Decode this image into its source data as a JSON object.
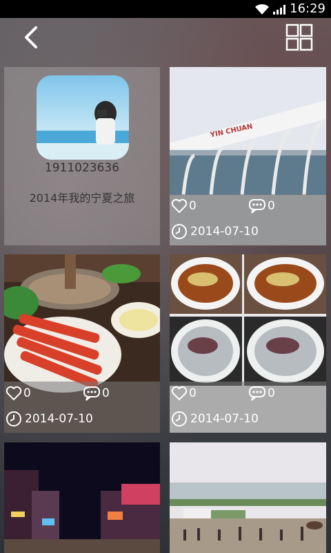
{
  "status": {
    "time": "16:29"
  },
  "header": {
    "back_icon": "back-arrow-icon",
    "grid_icon": "grid-view-icon"
  },
  "profile": {
    "user_id": "1911023636",
    "album_title": "2014年我的宁夏之旅"
  },
  "cards": [
    {
      "likes": "0",
      "comments": "0",
      "date": "2014-07-10",
      "photo": "Yinchuan airport terminal",
      "watermark": "YIN CHUAN"
    },
    {
      "likes": "0",
      "comments": "0",
      "date": "2014-07-10",
      "photo": "hotpot dinner with raw meat"
    },
    {
      "likes": "0",
      "comments": "0",
      "date": "2014-07-10",
      "photo": "noodle bowls collage"
    },
    {
      "photo": "night street scene"
    },
    {
      "photo": "lakeside with horses"
    }
  ],
  "colors": {
    "card_overlay": "#7a7a7a",
    "status_bar": "#000000"
  }
}
